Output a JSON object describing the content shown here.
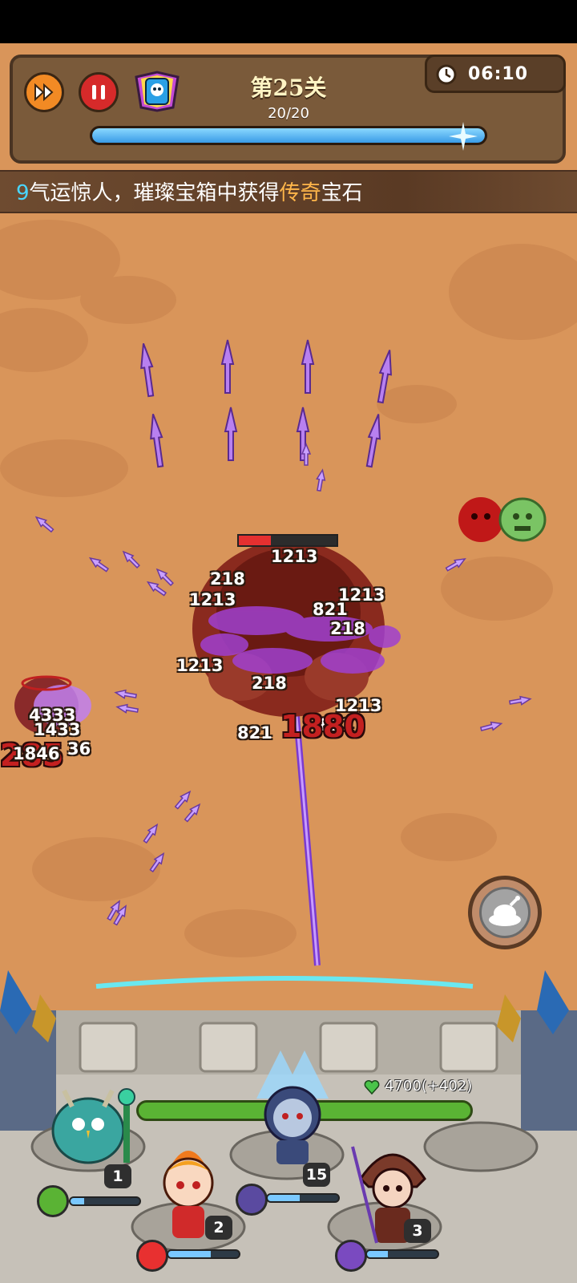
{
  "hud": {
    "level_title": "第25关",
    "wave_progress_text": "20/20",
    "wave_progress_fraction": 1.0,
    "timer": "06:10",
    "buttons": {
      "speed_icon": "fast-forward-icon",
      "pause_icon": "pause-icon",
      "gem_icon": "skull-card-icon"
    }
  },
  "ticker": {
    "prefix": "9",
    "part1": "气运惊人，璀璨宝箱中获得",
    "highlight": "传奇",
    "part2": "宝石"
  },
  "battle": {
    "boss_hp_fraction": 0.33,
    "damage_numbers": [
      "1213",
      "218",
      "1213",
      "1213",
      "821",
      "218",
      "1213",
      "218",
      "1213",
      "821",
      "821",
      "4333",
      "1433",
      "1846",
      "36"
    ],
    "big_damage": [
      "1880",
      "285"
    ],
    "food_button_icon": "roast-chicken-icon"
  },
  "team": {
    "hp_text": "4700(+402)",
    "heroes": [
      {
        "level": "1",
        "skill_icon": "wave-icon",
        "mana_fraction": 0.2
      },
      {
        "level": "2",
        "skill_icon": "target-icon",
        "mana_fraction": 0.6
      },
      {
        "level": "15",
        "skill_icon": "arrows-icon",
        "mana_fraction": 0.45
      },
      {
        "level": "3",
        "skill_icon": "bow-icon",
        "mana_fraction": 0.3
      }
    ]
  },
  "colors": {
    "sand": "#d9955a",
    "hud_brown": "#7a5a3a",
    "progress_blue": "#3a9be6",
    "team_hp_green": "#5ab334",
    "purple_arrow": "#9a5ae0"
  }
}
